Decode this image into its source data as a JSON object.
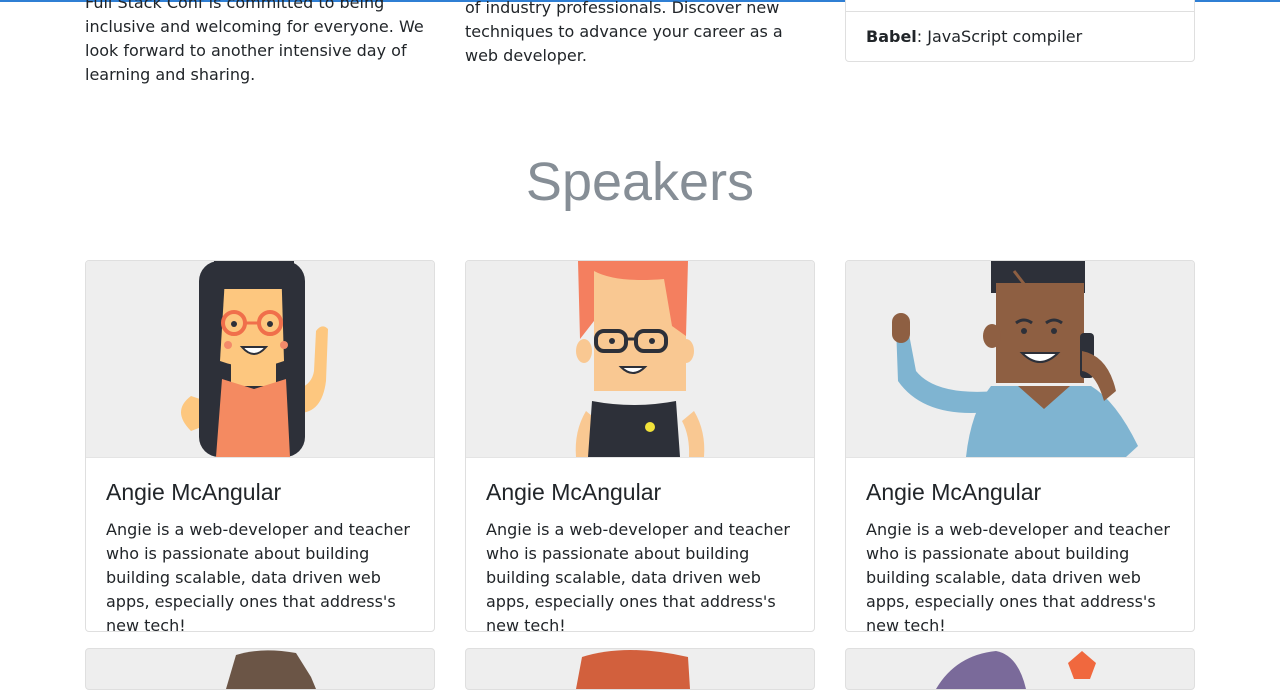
{
  "intro": {
    "col1_text": "Full Stack Conf is committed to being inclusive and welcoming for everyone. We look forward to another intensive day of learning and sharing.",
    "col2_text": "of industry professionals. Discover new techniques to advance your career as a web developer."
  },
  "tools": {
    "items": [
      {
        "name": "Babel",
        "desc": ": JavaScript compiler"
      }
    ]
  },
  "speakers": {
    "title": "Speakers",
    "cards": [
      {
        "name": "Angie McAngular",
        "bio": "Angie is a web-developer and teacher who is passionate about building building scalable, data driven web apps, especially ones that address's new tech!"
      },
      {
        "name": "Angie McAngular",
        "bio": "Angie is a web-developer and teacher who is passionate about building building scalable, data driven web apps, especially ones that address's new tech!"
      },
      {
        "name": "Angie McAngular",
        "bio": "Angie is a web-developer and teacher who is passionate about building building scalable, data driven web apps, especially ones that address's new tech!"
      }
    ]
  },
  "colors": {
    "accent_line": "#2f7fd4",
    "title": "#868e96",
    "card_image_bg": "#eeeeee"
  },
  "icons": [
    "speaker-illustration-woman-glasses",
    "speaker-illustration-redhead",
    "speaker-illustration-man-phone"
  ]
}
